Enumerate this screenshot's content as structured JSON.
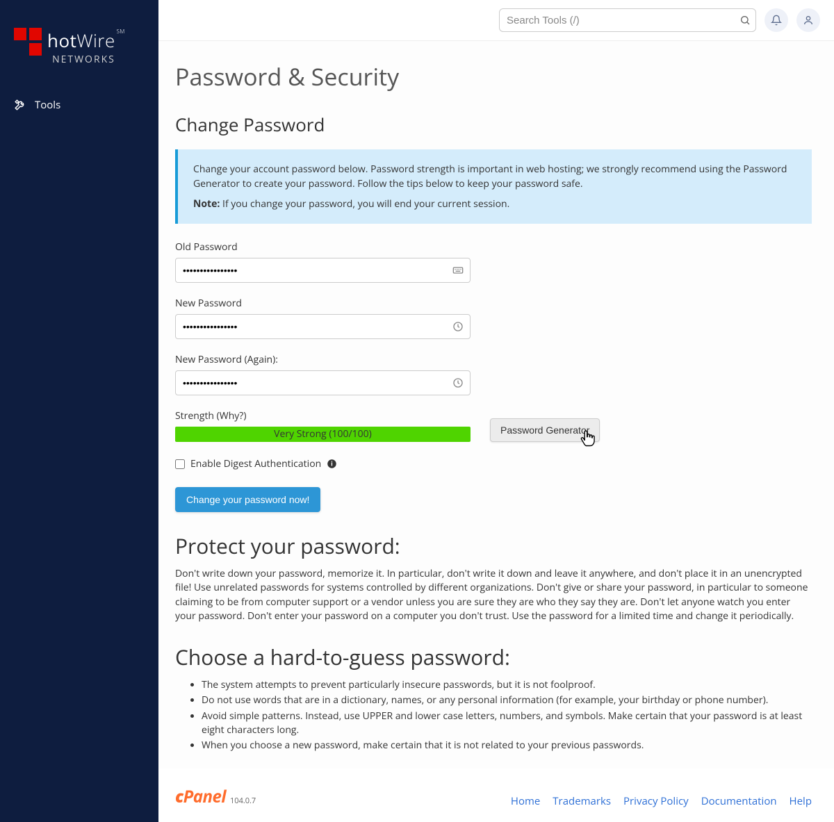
{
  "brand": {
    "line1a": "hot",
    "line1b": "Wire",
    "sm": "SM",
    "line2": "NETWORKS"
  },
  "sidebar": {
    "items": [
      {
        "label": "Tools"
      }
    ]
  },
  "search": {
    "placeholder": "Search Tools (/)",
    "value": ""
  },
  "page": {
    "title": "Password & Security",
    "section_title": "Change Password"
  },
  "info": {
    "p1": "Change your account password below. Password strength is important in web hosting; we strongly recommend using the Password Generator to create your password. Follow the tips below to keep your password safe.",
    "note_label": "Note:",
    "note_text": " If you change your password, you will end your current session."
  },
  "form": {
    "old_label": "Old Password",
    "old_value": "••••••••••••••••",
    "new_label": "New Password",
    "new_value": "••••••••••••••••",
    "again_label": "New Password (Again):",
    "again_value": "••••••••••••••••",
    "strength_label": "Strength (Why?)",
    "strength_text": "Very Strong (100/100)",
    "generator_btn": "Password Generator",
    "digest_label": "Enable Digest Authentication",
    "submit_btn": "Change your password now!"
  },
  "protect": {
    "title": "Protect your password:",
    "text": "Don't write down your password, memorize it. In particular, don't write it down and leave it anywhere, and don't place it in an unencrypted file! Use unrelated passwords for systems controlled by different organizations. Don't give or share your password, in particular to someone claiming to be from computer support or a vendor unless you are sure they are who they say they are. Don't let anyone watch you enter your password. Don't enter your password on a computer you don't trust. Use the password for a limited time and change it periodically."
  },
  "choose": {
    "title": "Choose a hard-to-guess password:",
    "tips": [
      "The system attempts to prevent particularly insecure passwords, but it is not foolproof.",
      "Do not use words that are in a dictionary, names, or any personal information (for example, your birthday or phone number).",
      "Avoid simple patterns. Instead, use UPPER and lower case letters, numbers, and symbols. Make certain that your password is at least eight characters long.",
      "When you choose a new password, make certain that it is not related to your previous passwords."
    ]
  },
  "footer": {
    "brand_c": "c",
    "brand_panel": "Panel",
    "version": "104.0.7",
    "links": [
      "Home",
      "Trademarks",
      "Privacy Policy",
      "Documentation",
      "Help"
    ]
  }
}
